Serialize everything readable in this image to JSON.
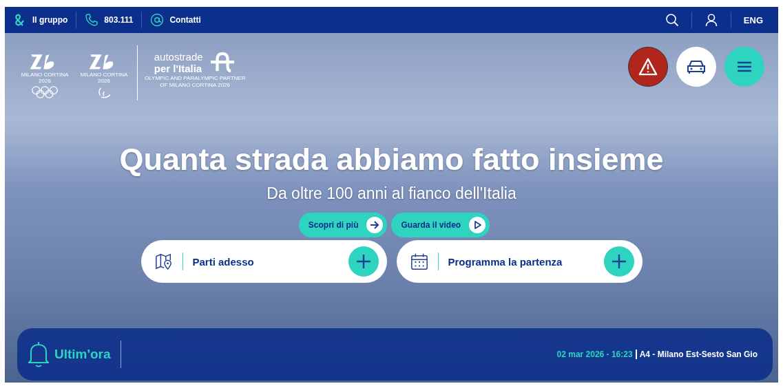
{
  "top_bar": {
    "links": [
      {
        "label": "Il gruppo",
        "kind": "group"
      },
      {
        "label": "803.111",
        "kind": "phone"
      },
      {
        "label": "Contatti",
        "kind": "at"
      }
    ],
    "language": "ENG"
  },
  "logos": {
    "games": [
      {
        "name": "MILANO CORTINA",
        "year": "2026",
        "kind": "olympic"
      },
      {
        "name": "MILANO CORTINA",
        "year": "2026",
        "kind": "paralympic"
      }
    ],
    "brand": {
      "line_1": "autostrade",
      "line_2": "per l'Italia",
      "tagline_1": "OLYMPIC AND PARALYMPIC PARTNER",
      "tagline_2": "OF MILANO CORTINA 2026"
    }
  },
  "action_buttons": [
    {
      "kind": "alert"
    },
    {
      "kind": "traffic"
    },
    {
      "kind": "menu"
    }
  ],
  "hero": {
    "title": "Quanta strada abbiamo fatto insieme",
    "subtitle": "Da oltre 100 anni al fianco dell'Italia",
    "buttons": [
      {
        "label": "Scopri di più",
        "kind": "arrow"
      },
      {
        "label": "Guarda il video",
        "kind": "play"
      }
    ]
  },
  "planner": [
    {
      "label": "Parti adesso",
      "kind": "map"
    },
    {
      "label": "Programma la partenza",
      "kind": "calendar"
    }
  ],
  "news": {
    "title": "Ultim'ora",
    "date": "02 mar 2026 - 16:23",
    "text": "A4 - Milano Est-Sesto San Gio"
  }
}
